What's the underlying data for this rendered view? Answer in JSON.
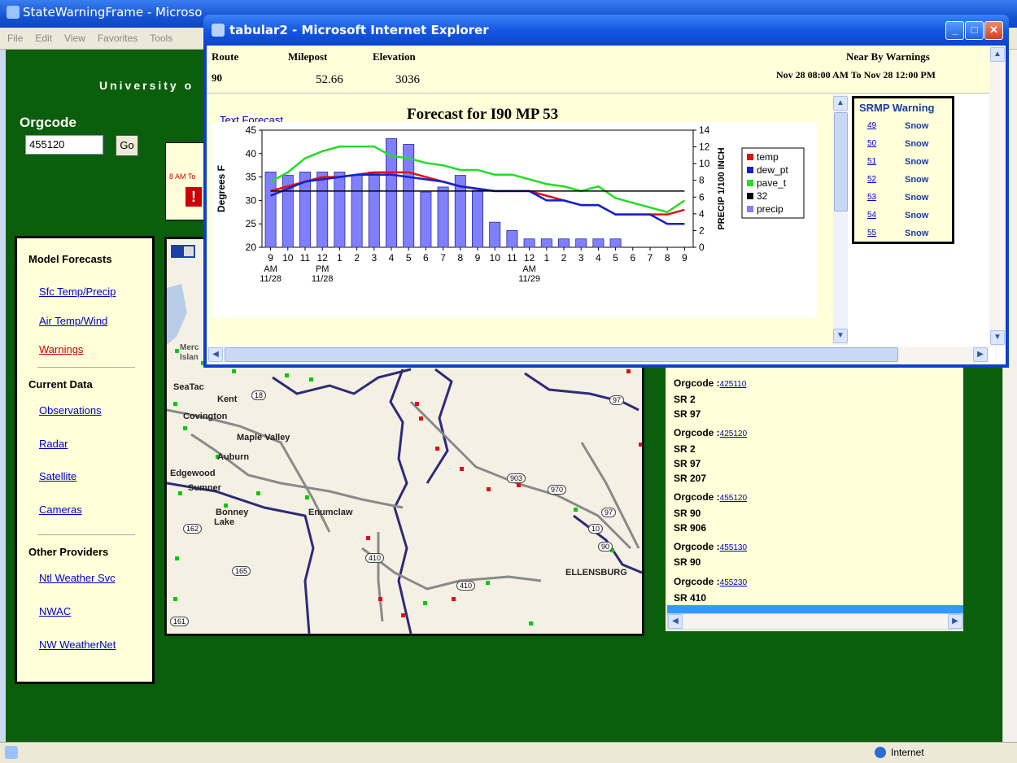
{
  "back_window": {
    "title": "StateWarningFrame - Microsoft Internet Explorer",
    "title_visible": "StateWarningFrame - Microso",
    "menu": [
      "File",
      "Edit",
      "View",
      "Favorites",
      "Tools"
    ],
    "banner_visible": "University o",
    "orgcode_label": "Orgcode",
    "orgcode_value": "455120",
    "go_label": "Go",
    "alert_fragment": "8 AM To",
    "status_zone": "Internet"
  },
  "sidebar": {
    "sections": [
      {
        "title": "Model Forecasts",
        "items": [
          {
            "label": "Sfc Temp/Precip"
          },
          {
            "label": "Air Temp/Wind"
          },
          {
            "label": "Warnings",
            "color": "#cc0000"
          }
        ]
      },
      {
        "title": "Current Data",
        "items": [
          {
            "label": "Observations"
          },
          {
            "label": "Radar"
          },
          {
            "label": "Satellite"
          },
          {
            "label": "Cameras"
          }
        ]
      },
      {
        "title": "Other Providers",
        "items": [
          {
            "label": "Ntl Weather Svc"
          },
          {
            "label": "NWAC"
          },
          {
            "label": "NW WeatherNet"
          }
        ]
      }
    ]
  },
  "map": {
    "labels": [
      "Merc",
      "Islan",
      "SeaTac",
      "Kent",
      "Covington",
      "Maple Valley",
      "Auburn",
      "Edgewood",
      "Sumner",
      "Bonney",
      "Lake",
      "Enumclaw",
      "ELLENSBURG"
    ],
    "route_shields": [
      "18",
      "97",
      "903",
      "970",
      "97",
      "10",
      "90",
      "410",
      "410",
      "165",
      "162",
      "161"
    ]
  },
  "org_list": [
    {
      "label": "Orgcode :",
      "code": "425110",
      "routes": [
        "SR 2",
        "SR 97"
      ]
    },
    {
      "label": "Orgcode :",
      "code": "425120",
      "routes": [
        "SR 2",
        "SR 97",
        "SR 207"
      ]
    },
    {
      "label": "Orgcode :",
      "code": "455120",
      "routes": [
        "SR 90",
        "SR 906"
      ]
    },
    {
      "label": "Orgcode :",
      "code": "455130",
      "routes": [
        "SR 90"
      ]
    },
    {
      "label": "Orgcode :",
      "code": "455230",
      "routes": [
        "SR 410"
      ]
    }
  ],
  "popup": {
    "title": "tabular2 - Microsoft Internet Explorer",
    "header": {
      "route_label": "Route",
      "route_value": "90",
      "milepost_label": "Milepost",
      "milepost_value": "52.66",
      "elevation_label": "Elevation",
      "elevation_value": "3036",
      "warnings_label": "Near By Warnings",
      "warnings_range": "Nov 28 08:00 AM To Nov 28 12:00 PM"
    },
    "text_forecast_link": "Text Forecast",
    "srmp": {
      "header": "SRMP Warning",
      "rows": [
        {
          "srmp": "49",
          "warning": "Snow"
        },
        {
          "srmp": "50",
          "warning": "Snow"
        },
        {
          "srmp": "51",
          "warning": "Snow"
        },
        {
          "srmp": "52",
          "warning": "Snow"
        },
        {
          "srmp": "53",
          "warning": "Snow"
        },
        {
          "srmp": "54",
          "warning": "Snow"
        },
        {
          "srmp": "55",
          "warning": "Snow"
        }
      ]
    }
  },
  "chart_data": {
    "type": "bar",
    "title": "Forecast for I90 MP 53",
    "ylabel": "Degrees F",
    "y2label": "PRECIP 1/100 INCH",
    "ylim": [
      20,
      45
    ],
    "y2lim": [
      0,
      14
    ],
    "yticks": [
      20,
      25,
      30,
      35,
      40,
      45
    ],
    "y2ticks": [
      0,
      2,
      4,
      6,
      8,
      10,
      12,
      14
    ],
    "categories": [
      "9",
      "10",
      "11",
      "12",
      "1",
      "2",
      "3",
      "4",
      "5",
      "6",
      "7",
      "8",
      "9",
      "10",
      "11",
      "12",
      "1",
      "2",
      "3",
      "4",
      "5",
      "6",
      "7",
      "8",
      "9"
    ],
    "sub_labels": [
      {
        "index": 0,
        "lines": [
          "AM",
          "11/28"
        ]
      },
      {
        "index": 3,
        "lines": [
          "PM",
          "11/28"
        ]
      },
      {
        "index": 15,
        "lines": [
          "AM",
          "11/29"
        ]
      }
    ],
    "legend_position": "right",
    "series": [
      {
        "name": "precip",
        "type": "bar",
        "axis": "y2",
        "color": "#8080ff",
        "values": [
          9,
          8.6,
          9,
          9,
          9,
          8.6,
          9,
          13,
          12.3,
          6.6,
          7.2,
          8.6,
          6.8,
          3,
          2,
          1,
          1,
          1,
          1,
          1,
          1,
          null,
          null,
          null,
          null
        ]
      },
      {
        "name": "temp",
        "type": "line",
        "axis": "y",
        "color": "#e01010",
        "values": [
          32,
          33,
          34,
          35,
          35,
          35.5,
          36,
          36,
          36,
          35,
          34,
          33,
          32.5,
          32,
          32,
          32,
          31,
          30,
          29,
          29,
          27,
          27,
          27,
          27,
          28
        ]
      },
      {
        "name": "dew_pt",
        "type": "line",
        "axis": "y",
        "color": "#1020d0",
        "values": [
          31,
          32.5,
          34,
          34.5,
          35,
          35.5,
          35.5,
          35.5,
          35,
          34.5,
          34,
          33,
          32.5,
          32,
          32,
          32,
          30,
          30,
          29,
          29,
          27,
          27,
          27,
          25,
          25
        ]
      },
      {
        "name": "pave_t",
        "type": "line",
        "axis": "y",
        "color": "#22dd22",
        "values": [
          34,
          36,
          39,
          40.5,
          41.5,
          41.5,
          41.5,
          39.5,
          39,
          38,
          37.5,
          36.5,
          36.5,
          35.5,
          35.5,
          34.5,
          33.5,
          33,
          32,
          33,
          30.5,
          29.5,
          28.5,
          27.5,
          30
        ]
      },
      {
        "name": "32",
        "type": "line",
        "axis": "y",
        "color": "#000000",
        "values": [
          32,
          32,
          32,
          32,
          32,
          32,
          32,
          32,
          32,
          32,
          32,
          32,
          32,
          32,
          32,
          32,
          32,
          32,
          32,
          32,
          32,
          32,
          32,
          32,
          32
        ]
      }
    ]
  }
}
